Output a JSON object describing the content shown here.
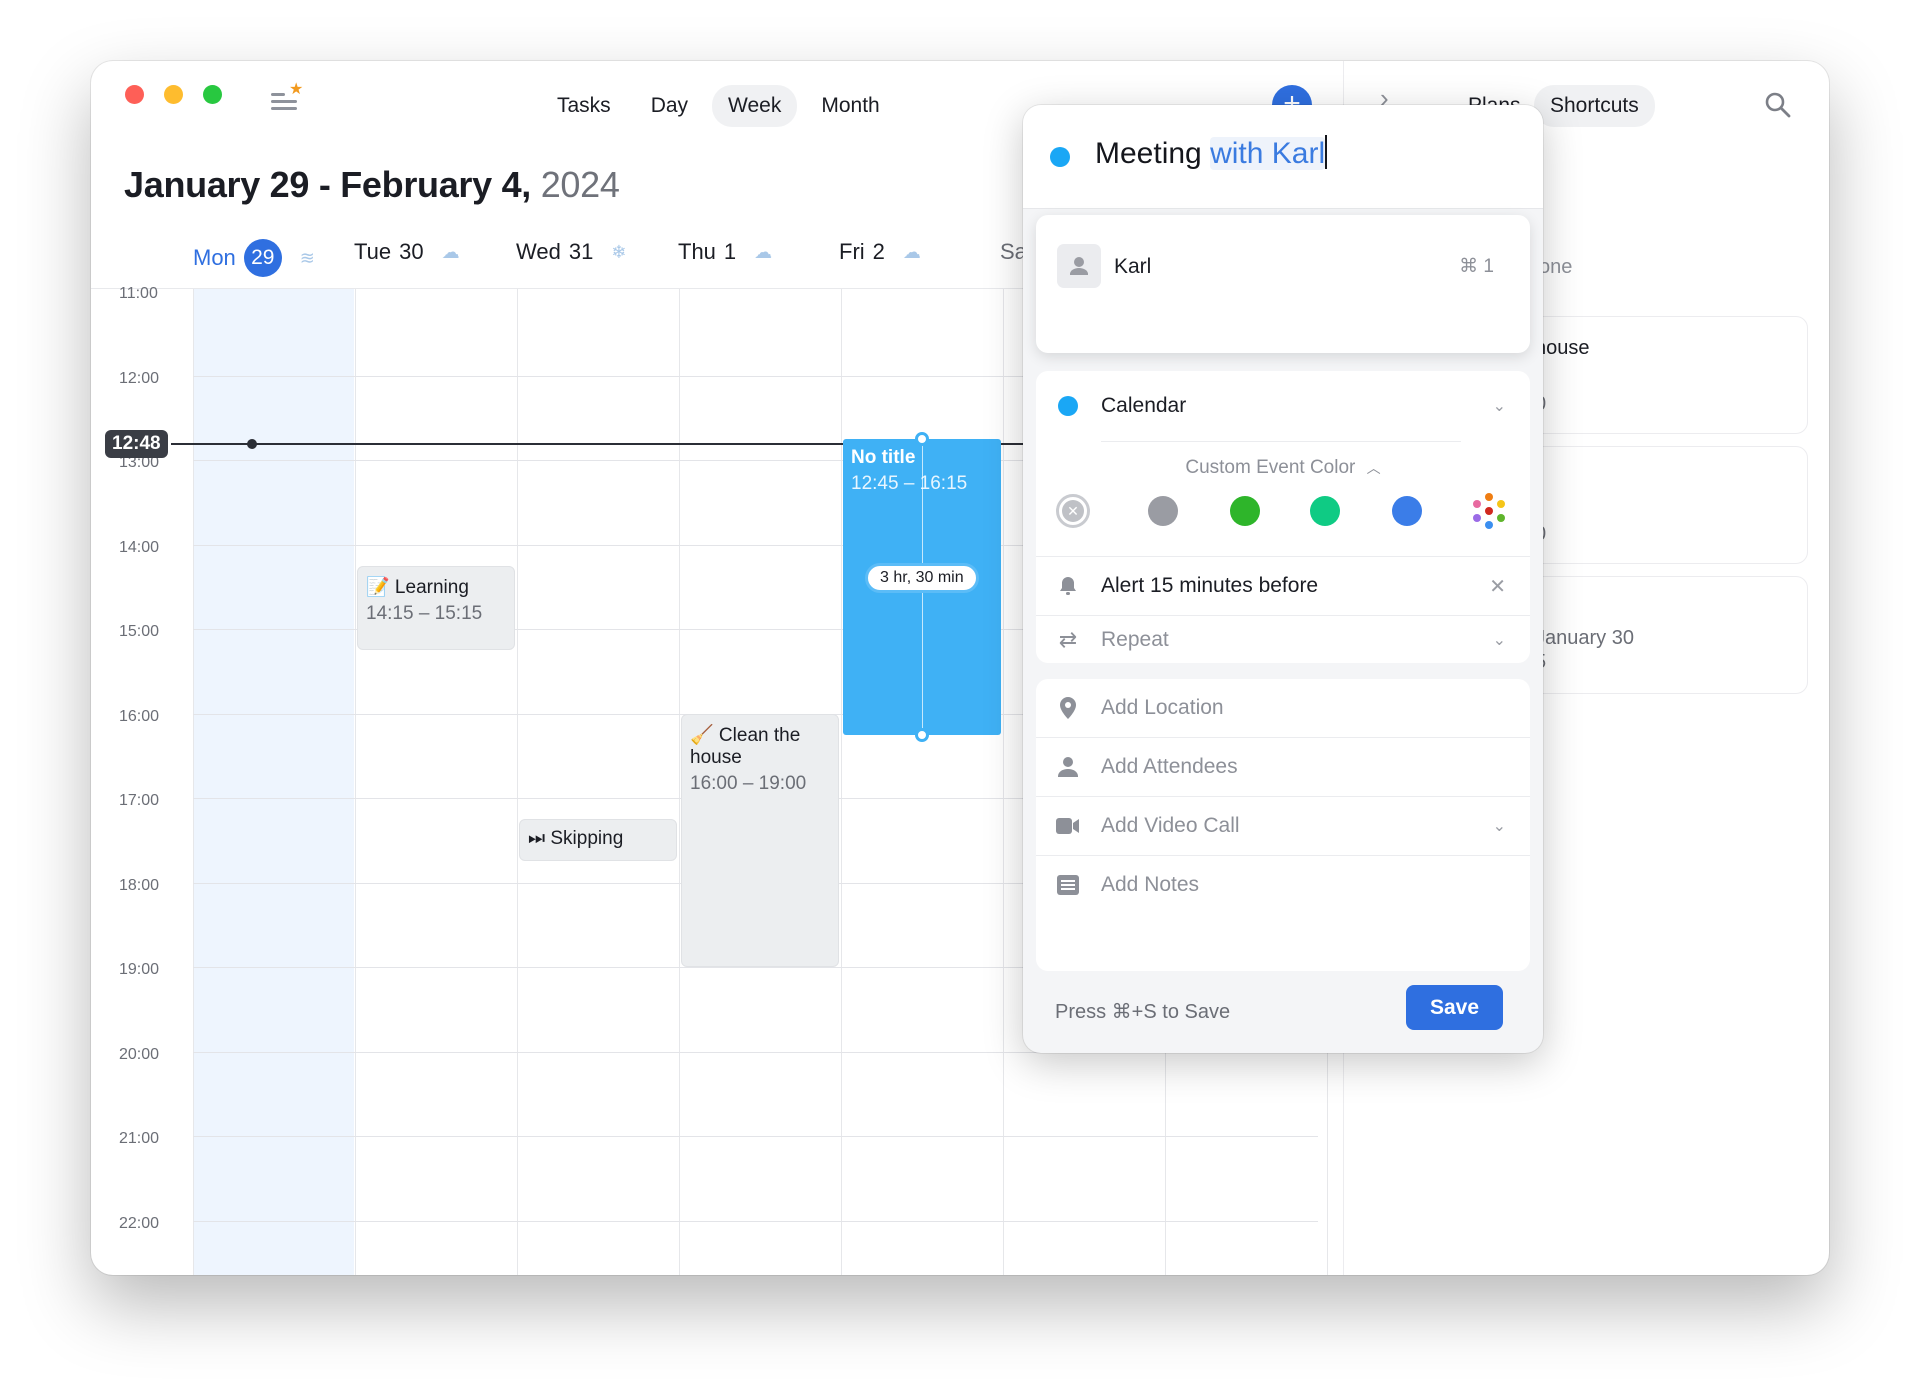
{
  "window": {
    "traffic_lights": [
      "close",
      "minimize",
      "zoom"
    ]
  },
  "toolbar": {
    "sidebar_icon": "sidebar-star-icon",
    "nav": [
      {
        "label": "Tasks",
        "active": false
      },
      {
        "label": "Day",
        "active": false
      },
      {
        "label": "Week",
        "active": true
      },
      {
        "label": "Month",
        "active": false
      }
    ],
    "add_icon": "plus-icon"
  },
  "header": {
    "title_main": "January 29 - February 4,",
    "title_year": "2024"
  },
  "days": [
    {
      "name": "Mon",
      "date": "29",
      "today": true,
      "weather": "wind-icon"
    },
    {
      "name": "Tue",
      "date": "30",
      "today": false,
      "weather": "cloud-icon"
    },
    {
      "name": "Wed",
      "date": "31",
      "today": false,
      "weather": "snow-icon"
    },
    {
      "name": "Thu",
      "date": "1",
      "today": false,
      "weather": "cloud-icon"
    },
    {
      "name": "Fri",
      "date": "2",
      "today": false,
      "weather": "cloud-icon"
    },
    {
      "name": "Sa",
      "date": "",
      "today": false,
      "weather": ""
    }
  ],
  "hours": [
    "11:00",
    "12:00",
    "13:00",
    "14:00",
    "15:00",
    "16:00",
    "17:00",
    "18:00",
    "19:00",
    "20:00",
    "21:00",
    "22:00"
  ],
  "now": {
    "label": "12:48"
  },
  "events": [
    {
      "title": "Learning",
      "emoji": "📝",
      "time": "14:15 – 15:15",
      "day": 1,
      "start": 14.25,
      "end": 15.25,
      "style": "gray"
    },
    {
      "title": "Clean the house",
      "emoji": "🧹",
      "time": "16:00 – 19:00",
      "day": 3,
      "start": 16.0,
      "end": 19.0,
      "style": "gray"
    },
    {
      "title": "Skipping",
      "emoji": "⏭",
      "time": "",
      "day": 2,
      "start": 17.25,
      "end": 17.75,
      "style": "gray"
    },
    {
      "title": "No title",
      "emoji": "",
      "time": "12:45 – 16:15",
      "day": 4,
      "start": 12.75,
      "end": 16.25,
      "style": "blue",
      "duration": "3 hr, 30 min"
    }
  ],
  "right_panel": {
    "tabs": [
      {
        "label": "Plans",
        "active": false
      },
      {
        "label": "Shortcuts",
        "active": true
      }
    ],
    "partial_texts": [
      "one",
      "house",
      "0",
      "0",
      "January 30",
      "5"
    ]
  },
  "popup": {
    "title_plain": "Meeting ",
    "title_highlight": "with Karl",
    "title_color": "#1aa7f5",
    "suggestion": {
      "name": "Karl",
      "shortcut": "⌘ 1"
    },
    "calendar": {
      "label": "Calendar",
      "color": "#1aa7f5"
    },
    "custom_color_label": "Custom Event Color",
    "swatches": [
      {
        "name": "none",
        "color": "#c9cbd0"
      },
      {
        "name": "gray",
        "color": "#9a9ca3"
      },
      {
        "name": "green",
        "color": "#2eb52a"
      },
      {
        "name": "teal",
        "color": "#0fcb84"
      },
      {
        "name": "blue",
        "color": "#3b7de8"
      },
      {
        "name": "more-colors",
        "color": "multi"
      }
    ],
    "alert": "Alert 15 minutes before",
    "repeat": "Repeat",
    "location_placeholder": "Add Location",
    "attendees_placeholder": "Add Attendees",
    "video_placeholder": "Add Video Call",
    "notes_placeholder": "Add Notes",
    "save_hint": "Press ⌘+S to Save",
    "save_label": "Save"
  }
}
